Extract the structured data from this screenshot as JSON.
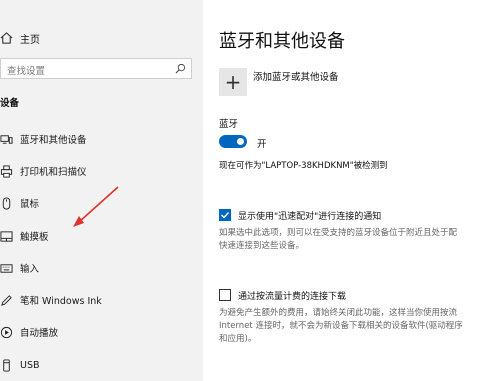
{
  "sidebar": {
    "home_label": "主页",
    "search_placeholder": "查找设置",
    "section_title": "设备",
    "items": [
      {
        "label": "蓝牙和其他设备",
        "icon": "bluetooth-devices-icon"
      },
      {
        "label": "打印机和扫描仪",
        "icon": "printer-icon"
      },
      {
        "label": "鼠标",
        "icon": "mouse-icon"
      },
      {
        "label": "触摸板",
        "icon": "touchpad-icon"
      },
      {
        "label": "输入",
        "icon": "keyboard-icon"
      },
      {
        "label": "笔和 Windows Ink",
        "icon": "pen-icon"
      },
      {
        "label": "自动播放",
        "icon": "autoplay-icon"
      },
      {
        "label": "USB",
        "icon": "usb-icon"
      }
    ]
  },
  "main": {
    "title": "蓝牙和其他设备",
    "add_device_label": "添加蓝牙或其他设备",
    "bluetooth_label": "蓝牙",
    "bluetooth_state": "开",
    "discoverable_text": "现在可作为\"LAPTOP-38KHDKNM\"被检测到",
    "swift_pair": {
      "label": "显示使用\"迅速配对\"进行连接的通知",
      "checked": true,
      "desc_lines": [
        "如果选中此选项，则可以在受支持的蓝牙设备位于附近且处于配",
        "快速连接到这些设备。"
      ]
    },
    "metered": {
      "label": "通过按流量计费的连接下载",
      "checked": false,
      "desc_lines": [
        "为避免产生额外的费用，请始终关闭此功能，这样当你使用按流",
        "Internet 连接时，就不会为新设备下载相关的设备软件(驱动程序",
        "和应用)。"
      ]
    }
  },
  "colors": {
    "accent": "#0067c0",
    "annotation_arrow": "#e0332b",
    "sidebar_bg": "#f2f2f2"
  }
}
